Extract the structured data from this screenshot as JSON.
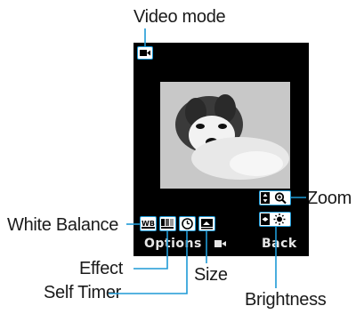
{
  "callouts": {
    "video_mode": "Video mode",
    "zoom": "Zoom",
    "white_balance": "White Balance",
    "effect": "Effect",
    "size": "Size",
    "self_timer": "Self Timer",
    "brightness": "Brightness"
  },
  "softkeys": {
    "left": "Options",
    "right": "Back"
  },
  "icons": {
    "video_mode": "video-camera-icon",
    "white_balance": "wb-icon",
    "effect": "effect-icon",
    "self_timer": "timer-icon",
    "size": "size-icon",
    "zoom": "zoom-icon",
    "brightness": "brightness-icon",
    "record": "record-icon"
  },
  "colors": {
    "accent": "#1e9ad6",
    "screen": "#000000",
    "text": "#1a1a1a"
  }
}
